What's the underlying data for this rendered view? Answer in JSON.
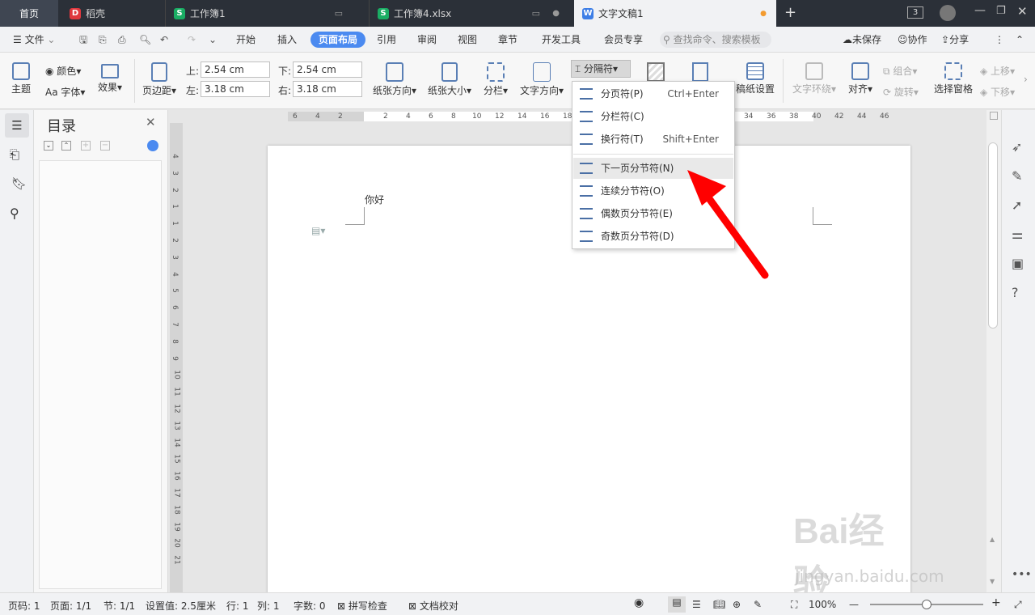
{
  "titlebar": {
    "tabs": [
      {
        "label": "首页"
      },
      {
        "label": "稻壳"
      },
      {
        "label": "工作簿1"
      },
      {
        "label": "工作簿4.xlsx"
      },
      {
        "label": "文字文稿1"
      }
    ],
    "new_tab": "+",
    "badge_count": "3"
  },
  "menubar": {
    "file": "文件",
    "tabs": [
      "开始",
      "插入",
      "页面布局",
      "引用",
      "审阅",
      "视图",
      "章节",
      "开发工具",
      "会员专享"
    ],
    "search_placeholder": "查找命令、搜索模板",
    "unsaved": "未保存",
    "collab": "协作",
    "share": "分享"
  },
  "ribbon": {
    "theme": "主题",
    "color": "颜色",
    "font": "字体",
    "effect": "效果",
    "margins": "页边距",
    "top_label": "上:",
    "top_value": "2.54 cm",
    "bottom_label": "下:",
    "bottom_value": "2.54 cm",
    "left_label": "左:",
    "left_value": "3.18 cm",
    "right_label": "右:",
    "right_value": "3.18 cm",
    "orientation": "纸张方向",
    "size": "纸张大小",
    "columns": "分栏",
    "text_direction": "文字方向",
    "breaks": "分隔符",
    "grid_paper": "稿纸设置",
    "text_wrap": "文字环绕",
    "align": "对齐",
    "group": "组合",
    "rotate": "旋转",
    "selection_pane": "选择窗格",
    "bring_forward": "上移",
    "send_backward": "下移"
  },
  "dropdown": {
    "items": [
      {
        "label": "分页符(P)",
        "shortcut": "Ctrl+Enter"
      },
      {
        "label": "分栏符(C)",
        "shortcut": ""
      },
      {
        "label": "换行符(T)",
        "shortcut": "Shift+Enter"
      },
      {
        "label": "下一页分节符(N)",
        "shortcut": ""
      },
      {
        "label": "连续分节符(O)",
        "shortcut": ""
      },
      {
        "label": "偶数页分节符(E)",
        "shortcut": ""
      },
      {
        "label": "奇数页分节符(D)",
        "shortcut": ""
      }
    ]
  },
  "nav": {
    "title": "目录"
  },
  "ruler": {
    "h_ticks": [
      "6",
      "4",
      "2",
      "2",
      "4",
      "6",
      "8",
      "10",
      "12",
      "14",
      "16",
      "18",
      "34",
      "36",
      "38",
      "40",
      "42",
      "44",
      "46"
    ],
    "v_ticks": [
      "4",
      "3",
      "2",
      "1",
      "1",
      "2",
      "3",
      "4",
      "5",
      "6",
      "7",
      "8",
      "9",
      "10",
      "11",
      "12",
      "13",
      "14",
      "15",
      "16",
      "17",
      "18",
      "19",
      "20",
      "21"
    ]
  },
  "document": {
    "text": "你好"
  },
  "statusbar": {
    "page": "页码: 1",
    "pages": "页面: 1/1",
    "section": "节: 1/1",
    "setting": "设置值: 2.5厘米",
    "row": "行: 1",
    "col": "列: 1",
    "words": "字数: 0",
    "spell": "拼写检查",
    "proof": "文档校对",
    "zoom": "100%"
  },
  "watermark": {
    "text": "Bai经验",
    "url": "jingyan.baidu.com"
  }
}
